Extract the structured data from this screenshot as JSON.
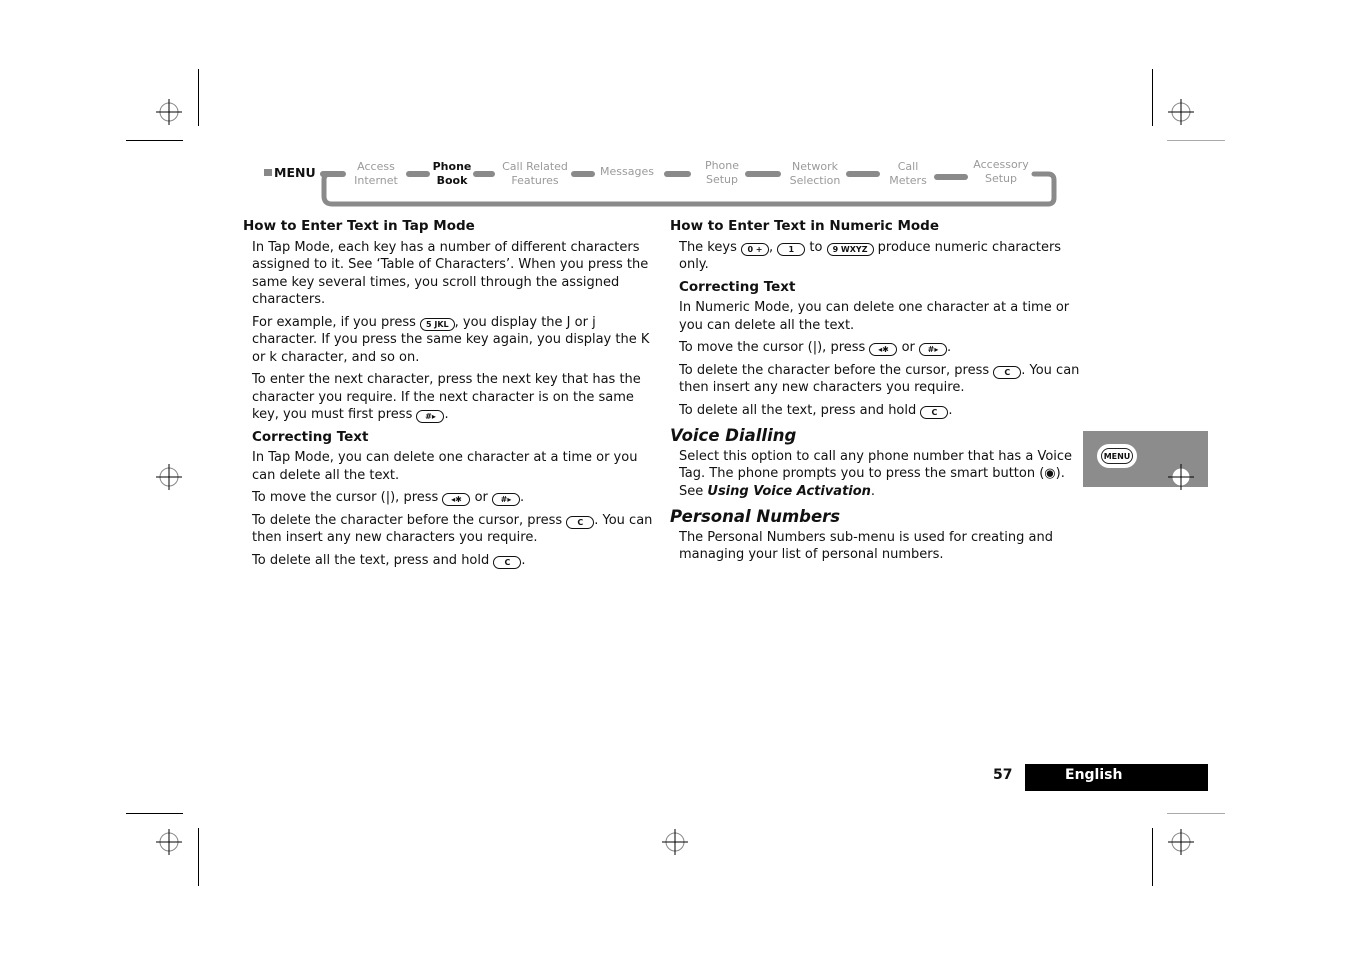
{
  "nav": {
    "menu_label": "MENU",
    "items": [
      {
        "line1": "Access",
        "line2": "Internet",
        "active": false
      },
      {
        "line1": "Phone",
        "line2": "Book",
        "active": true
      },
      {
        "line1": "Call Related",
        "line2": "Features",
        "active": false
      },
      {
        "line1": "Messages",
        "line2": "",
        "active": false
      },
      {
        "line1": "Phone",
        "line2": "Setup",
        "active": false
      },
      {
        "line1": "Network",
        "line2": "Selection",
        "active": false
      },
      {
        "line1": "Call",
        "line2": "Meters",
        "active": false
      },
      {
        "line1": "Accessory",
        "line2": "Setup",
        "active": false
      }
    ]
  },
  "left": {
    "title": "How to Enter Text in Tap Mode",
    "p1": "In Tap Mode, each key has a number of different characters assigned to it. See ‘Table of Characters’. When you press the same key several times, you scroll through the assigned characters.",
    "p2_a": "For example, if you press ",
    "p2_key": "5 JKL",
    "p2_b": ", you display the J or j character. If you press the same key again, you display the K or k character, and so on.",
    "p3_a": "To enter the next character, press the next key that has the character you require. If the next character is on the same key, you must first press ",
    "p3_key": "#▸",
    "p3_b": ".",
    "correcting_title": "Correcting Text",
    "c1": "In Tap Mode, you can delete one character at a time or you can delete all the text.",
    "c2_a": "To move the cursor (|), press ",
    "c2_key1": "◂✱",
    "c2_mid": " or ",
    "c2_key2": "#▸",
    "c2_b": ".",
    "c3_a": "To delete the character before the cursor, press ",
    "c3_key": "C",
    "c3_b": ". You can then insert any new characters you require.",
    "c4_a": "To delete all the text, press and hold ",
    "c4_key": "C",
    "c4_b": "."
  },
  "right": {
    "title": "How to Enter Text in Numeric Mode",
    "p1_a": "The keys ",
    "p1_key1": "0 +",
    "p1_sep": ", ",
    "p1_key2": "1",
    "p1_to": " to ",
    "p1_key3": "9 WXYZ",
    "p1_b": " produce numeric characters only.",
    "correcting_title": "Correcting Text",
    "c1": "In Numeric Mode, you can delete one character at a time or you can delete all the text.",
    "c2_a": "To move the cursor (|), press ",
    "c2_key1": "◂✱",
    "c2_mid": " or ",
    "c2_key2": "#▸",
    "c2_b": ".",
    "c3_a": "To delete the character before the cursor, press ",
    "c3_key": "C",
    "c3_b": ". You can then insert any new characters you require.",
    "c4_a": "To delete all the text, press and hold ",
    "c4_key": "C",
    "c4_b": ".",
    "voice_title": "Voice Dialling",
    "voice_a": "Select this option to call any phone number that has a Voice Tag. The phone prompts you to press the smart button (◉). See ",
    "voice_link": "Using Voice Activation",
    "voice_b": ".",
    "personal_title": "Personal Numbers",
    "personal_text": "The Personal Numbers sub-menu is used for creating and managing your list of personal numbers."
  },
  "side_tab": {
    "button_label": "MENU",
    "color": "#8c8c8c"
  },
  "footer": {
    "page_number": "57",
    "language": "English"
  }
}
